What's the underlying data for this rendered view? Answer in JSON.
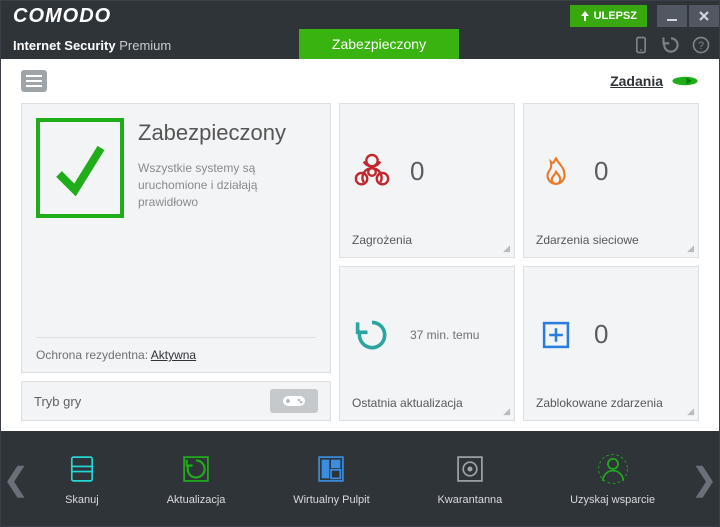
{
  "brand": "COMODO",
  "product": {
    "name": "Internet Security",
    "edition": "Premium"
  },
  "upgrade_label": "ULEPSZ",
  "status_pill": "Zabezpieczony",
  "tasks_label": "Zadania",
  "status": {
    "title": "Zabezpieczony",
    "subtitle": "Wszystkie systemy są uruchomione i działają prawidłowo",
    "realtime_label": "Ochrona rezydentna:",
    "realtime_value": "Aktywna"
  },
  "gamemode": {
    "label": "Tryb gry"
  },
  "tiles": {
    "threats": {
      "label": "Zagrożenia",
      "value": "0"
    },
    "network": {
      "label": "Zdarzenia sieciowe",
      "value": "0"
    },
    "update": {
      "label": "Ostatnia aktualizacja",
      "value": "37 min. temu"
    },
    "blocked": {
      "label": "Zablokowane zdarzenia",
      "value": "0"
    }
  },
  "actions": {
    "scan": "Skanuj",
    "update": "Aktualizacja",
    "virtual": "Wirtualny Pulpit",
    "quarantine": "Kwarantanna",
    "support": "Uzyskaj wsparcie"
  },
  "colors": {
    "accent_green": "#39b30f",
    "shield_green": "#1fae1a",
    "threat_red": "#c1272d",
    "fire_orange": "#e77b2a",
    "refresh_teal": "#2aa5a0",
    "add_blue": "#2a7de1"
  }
}
